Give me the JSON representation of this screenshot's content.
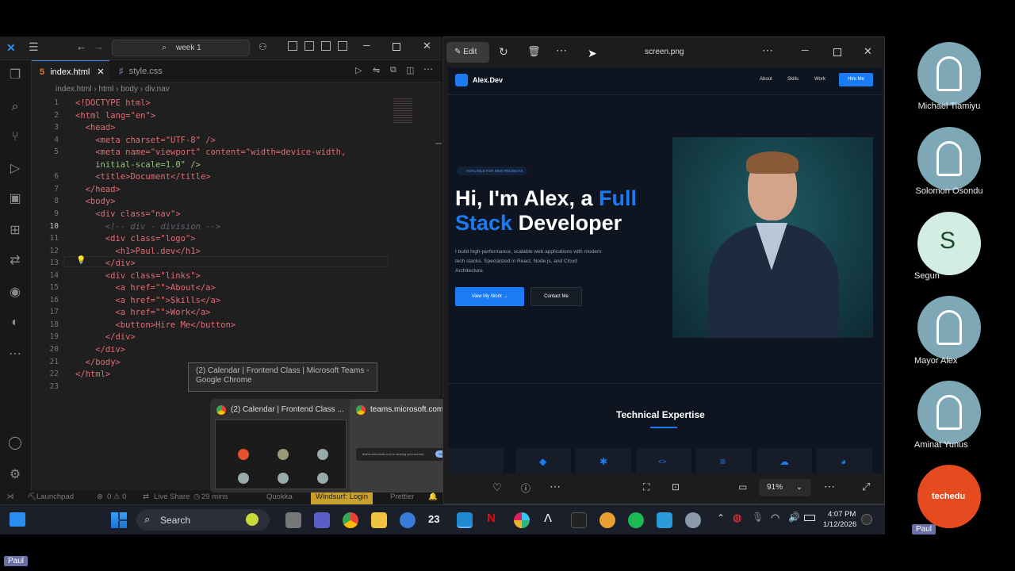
{
  "vscode": {
    "search_label": "week 1",
    "tabs": [
      {
        "label": "index.html"
      },
      {
        "label": "style.css"
      }
    ],
    "breadcrumb": [
      "index.html",
      "html",
      "body",
      "div.nav"
    ],
    "lines": [
      {
        "n": "1"
      },
      {
        "n": "2"
      },
      {
        "n": "3"
      },
      {
        "n": "4"
      },
      {
        "n": "5"
      },
      {
        "n": ""
      },
      {
        "n": "6"
      },
      {
        "n": "7"
      },
      {
        "n": "8"
      },
      {
        "n": "9"
      },
      {
        "n": "10"
      },
      {
        "n": "11"
      },
      {
        "n": "12"
      },
      {
        "n": "13"
      },
      {
        "n": "14"
      },
      {
        "n": "15"
      },
      {
        "n": "16"
      },
      {
        "n": "17"
      },
      {
        "n": "18"
      },
      {
        "n": "19"
      },
      {
        "n": "20"
      },
      {
        "n": "21"
      },
      {
        "n": "22"
      },
      {
        "n": "23"
      }
    ],
    "code": {
      "doctype": "<!DOCTYPE html>",
      "html_open": "<html lang=\"en\">",
      "head_open": "<head>",
      "meta_charset": "<meta charset=\"UTF-8\" />",
      "meta_viewport_1": "<meta name=\"viewport\" content=\"width=device-width,",
      "meta_viewport_2": "initial-scale=1.0\" />",
      "title": "<title>Document</title>",
      "head_close": "</head>",
      "body_open": "<body>",
      "div_nav": "<div class=\"nav\">",
      "comment": "<!-- div - division -->",
      "div_logo": "<div class=\"logo\">",
      "h1": "<h1>Paul.dev</h1>",
      "div_close_1": "</div>",
      "div_links": "<div class=\"links\">",
      "a_about": "<a href=\"\">About</a>",
      "a_skills": "<a href=\"\">Skills</a>",
      "a_work": "<a href=\"\">Work</a>",
      "button": "<button>Hire Me</button>",
      "div_close_2": "</div>",
      "div_close_3": "</div>",
      "body_close": "</body>",
      "html_close": "</html>"
    },
    "status": {
      "launchpad": "Launchpad",
      "problems": "0 ⚠ 0",
      "live_share": "Live Share",
      "time": "29 mins",
      "quokka": "Quokka",
      "windsurf": "Windsurf: Login",
      "prettier": "Prettier"
    }
  },
  "tooltip": {
    "text": "(2) Calendar | Frontend Class | Microsoft Teams - Google Chrome"
  },
  "popup": {
    "tab1": "(2) Calendar | Frontend Class ...",
    "tab2": "teams.microsoft.com is...",
    "thumb_bar_text": "teams.microsoft.com is sharing your screen.",
    "stop_sharing": "Stop sharing",
    "hide": "Hide"
  },
  "photos": {
    "edit_label": "Edit",
    "filename": "screen.png",
    "zoom": "91%",
    "site": {
      "brand": "Alex.Dev",
      "nav": [
        "About",
        "Skills",
        "Work"
      ],
      "hire": "Hire Me",
      "badge": "AVAILABLE FOR NEW PROJECTS",
      "hero_1a": "Hi, I'm Alex, a ",
      "hero_1b": "Full",
      "hero_2a": "Stack",
      "hero_2b": " Developer",
      "desc_1": "I build high-performance, scalable web applications with modern",
      "desc_2": "tech stacks. Specialized in React, Node.js, and Cloud",
      "desc_3": "Architecture.",
      "btn_primary": "View My Work",
      "btn_secondary": "Contact Me",
      "section_title": "Technical Expertise"
    }
  },
  "taskbar": {
    "search": "Search",
    "time": "4:07 PM",
    "date": "1/12/2026",
    "badge_23": "23"
  },
  "participants": [
    {
      "name": "Michael Tiamiyu"
    },
    {
      "name": "Solomon Osondu"
    },
    {
      "name": "Segun",
      "initial": "S"
    },
    {
      "name": "Mayor Alex"
    },
    {
      "name": "Aminat Yunus"
    },
    {
      "name": "Paul",
      "logo_text": "techedu"
    }
  ],
  "presenter": {
    "name": "Paul"
  },
  "colors": {
    "accent_blue": "#1a7cf5",
    "vscode_bg": "#1f1f1f",
    "participant": "#7fa8b6",
    "segun_bg": "#d4ede2",
    "techedu": "#e54b1f"
  }
}
